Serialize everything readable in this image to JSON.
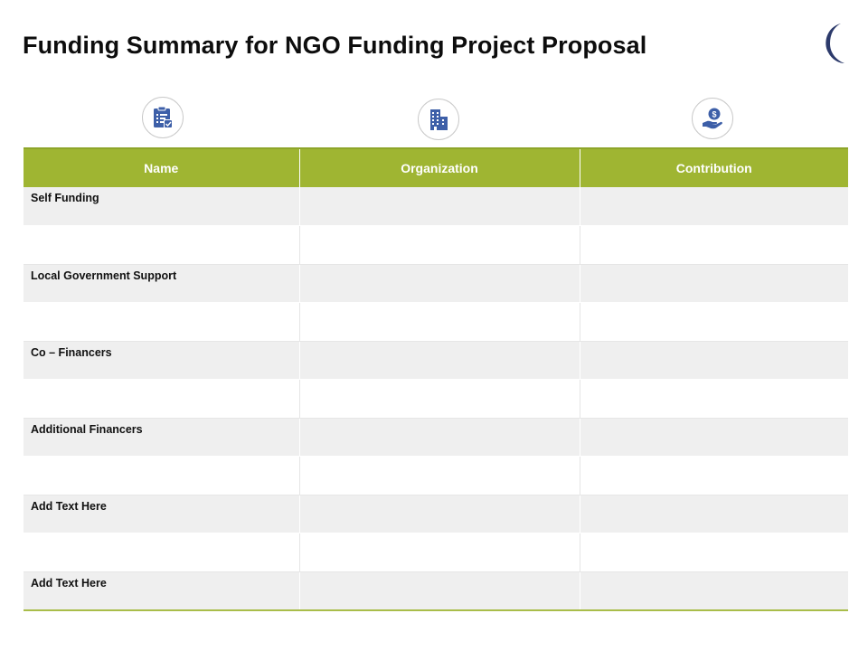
{
  "title": "Funding Summary for NGO Funding Project Proposal",
  "icons": [
    "clipboard-checklist-icon",
    "buildings-icon",
    "hand-dollar-icon"
  ],
  "colors": {
    "header_bg": "#9fb532",
    "row_shaded": "#efefef",
    "icon_blue": "#3d5fa8",
    "logo_navy": "#2c3a6b"
  },
  "table": {
    "headers": [
      "Name",
      "Organization",
      "Contribution"
    ],
    "rows": [
      [
        "Self Funding",
        "",
        ""
      ],
      [
        "",
        "",
        ""
      ],
      [
        "Local Government Support",
        "",
        ""
      ],
      [
        "",
        "",
        ""
      ],
      [
        "Co – Financers",
        "",
        ""
      ],
      [
        "",
        "",
        ""
      ],
      [
        "Additional  Financers",
        "",
        ""
      ],
      [
        "",
        "",
        ""
      ],
      [
        "Add  Text Here",
        "",
        ""
      ],
      [
        "",
        "",
        ""
      ],
      [
        "Add  Text Here",
        "",
        ""
      ]
    ]
  }
}
